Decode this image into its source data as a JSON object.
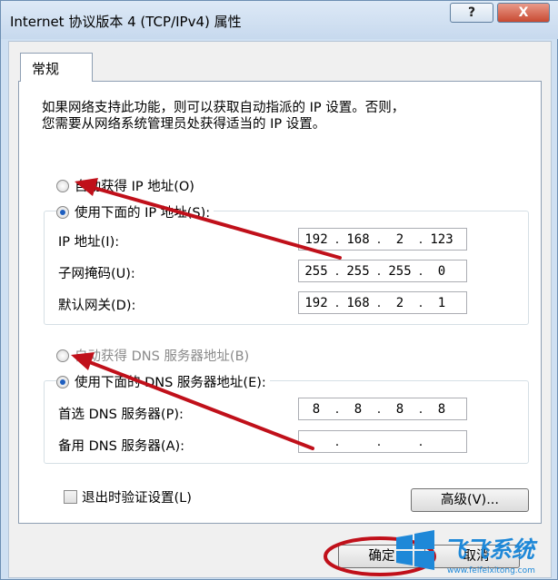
{
  "window": {
    "title": "Internet 协议版本 4 (TCP/IPv4) 属性",
    "help_label": "?",
    "close_label": "X"
  },
  "tab": {
    "label": "常规"
  },
  "description": {
    "line1": "如果网络支持此功能，则可以获取自动指派的 IP 设置。否则，",
    "line2": "您需要从网络系统管理员处获得适当的 IP 设置。"
  },
  "ip_section": {
    "auto_label": "自动获得 IP 地址(O)",
    "manual_label": "使用下面的 IP 地址(S):",
    "selected": "manual",
    "fields": [
      {
        "label": "IP 地址(I):",
        "octets": [
          "192",
          "168",
          "2",
          "123"
        ]
      },
      {
        "label": "子网掩码(U):",
        "octets": [
          "255",
          "255",
          "255",
          "0"
        ]
      },
      {
        "label": "默认网关(D):",
        "octets": [
          "192",
          "168",
          "2",
          "1"
        ]
      }
    ]
  },
  "dns_section": {
    "auto_label": "自动获得 DNS 服务器地址(B)",
    "manual_label": "使用下面的 DNS 服务器地址(E):",
    "selected": "manual",
    "fields": [
      {
        "label": "首选 DNS 服务器(P):",
        "octets": [
          "8",
          "8",
          "8",
          "8"
        ]
      },
      {
        "label": "备用 DNS 服务器(A):",
        "octets": [
          "",
          "",
          "",
          ""
        ]
      }
    ]
  },
  "validate_checkbox": {
    "label": "退出时验证设置(L)",
    "checked": false
  },
  "advanced_button": {
    "label": "高级(V)..."
  },
  "ok_button": {
    "label": "确定"
  },
  "cancel_button": {
    "label": "取消"
  },
  "watermark": {
    "text_cn": "飞飞系统",
    "url": "www.feifeixitong.com"
  },
  "colors": {
    "annotation_red": "#c0101a",
    "titlebar": "#c7d9ee",
    "radio_selected": "#1f5fbf"
  }
}
